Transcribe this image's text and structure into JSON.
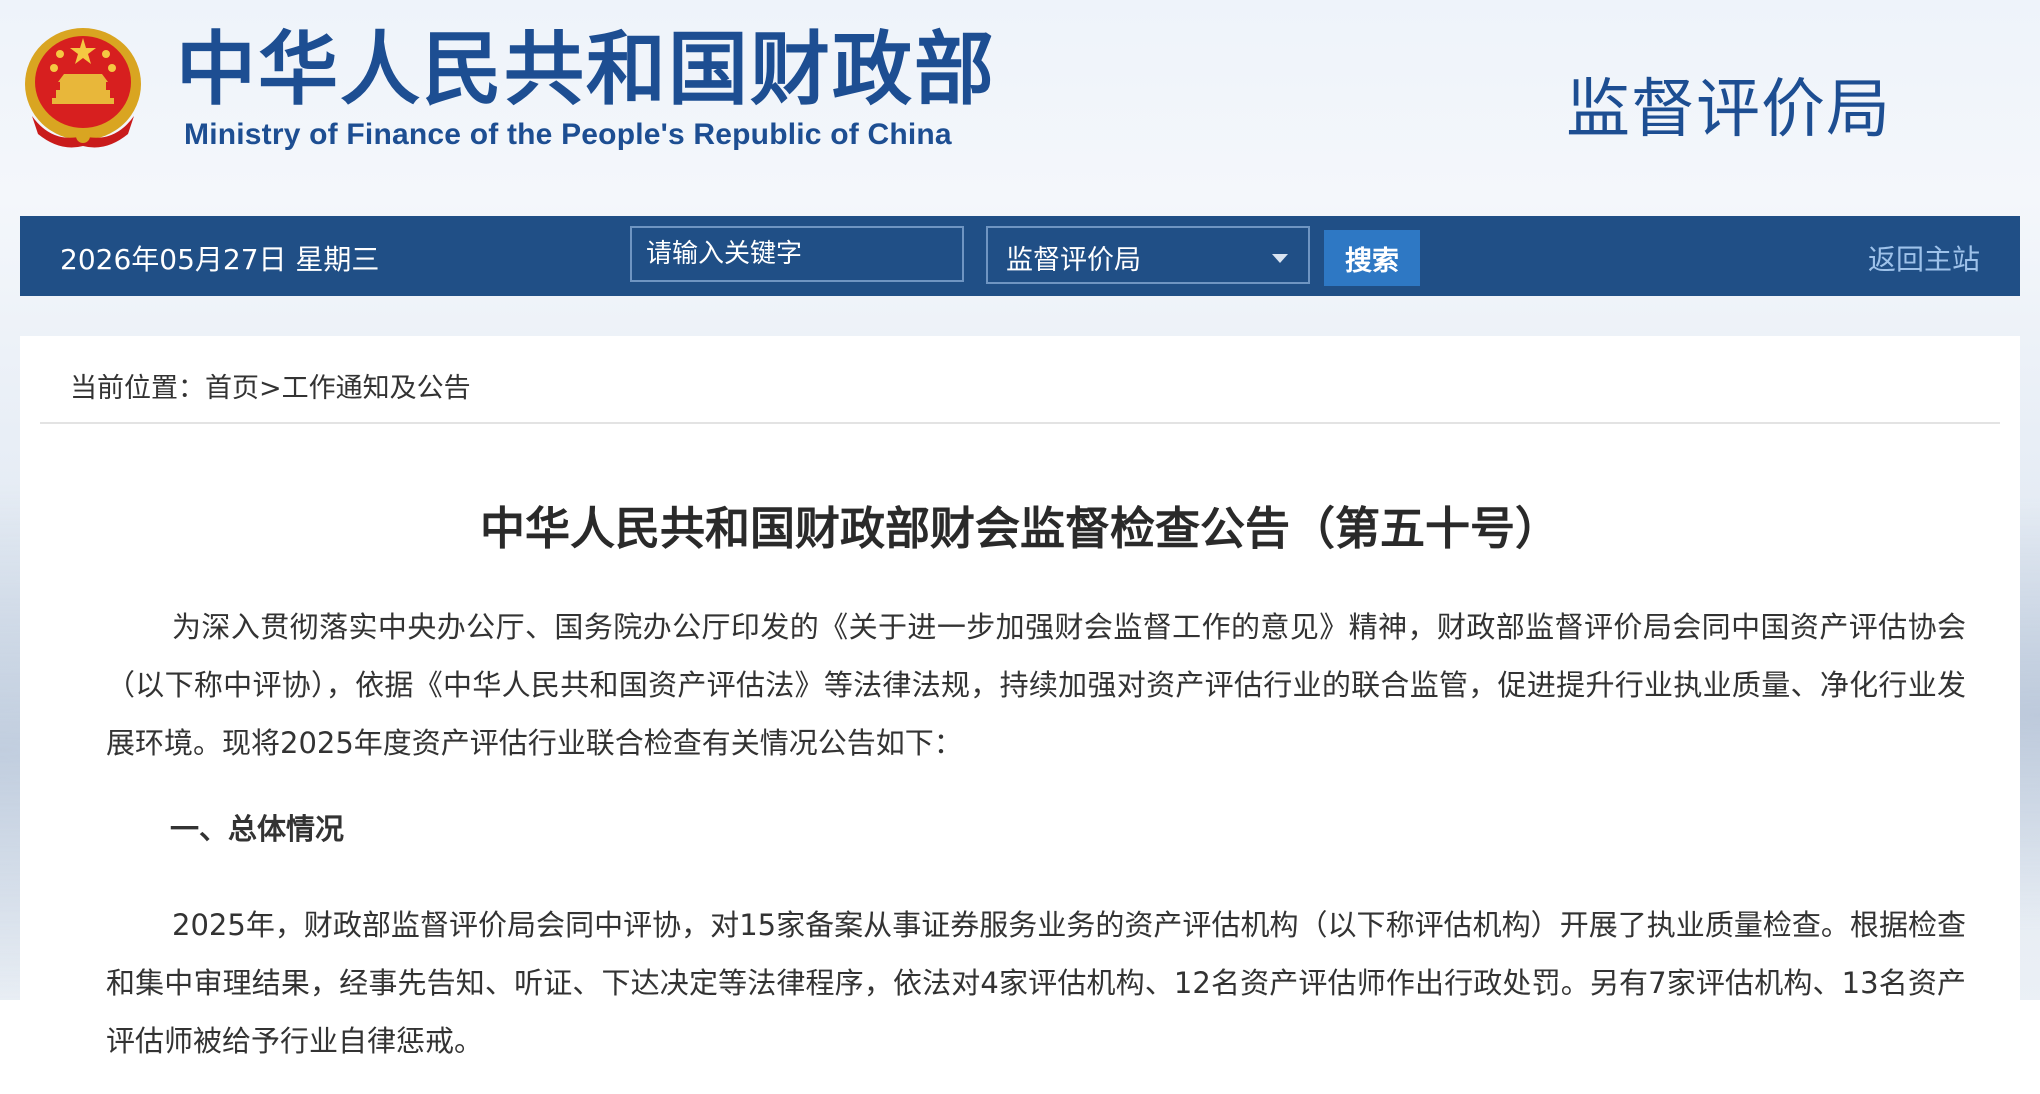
{
  "header": {
    "ministry_cn": "中华人民共和国财政部",
    "ministry_en": "Ministry of Finance of the People's Republic of China",
    "department": "监督评价局"
  },
  "navbar": {
    "date": "2026年05月27日  星期三",
    "search_placeholder": "请输入关键字",
    "scope_selected": "监督评价局",
    "search_button": "搜索",
    "home_link": "返回主站"
  },
  "breadcrumb": {
    "label": "当前位置：",
    "home": "首页",
    "separator": ">",
    "current": "工作通知及公告"
  },
  "article": {
    "title": "中华人民共和国财政部财会监督检查公告（第五十号）",
    "paragraph_1": "为深入贯彻落实中央办公厅、国务院办公厅印发的《关于进一步加强财会监督工作的意见》精神，财政部监督评价局会同中国资产评估协会（以下称中评协），依据《中华人民共和国资产评估法》等法律法规，持续加强对资产评估行业的联合监管，促进提升行业执业质量、净化行业发展环境。现将2025年度资产评估行业联合检查有关情况公告如下：",
    "section_1_heading": "一、总体情况",
    "paragraph_2": "2025年，财政部监督评价局会同中评协，对15家备案从事证券服务业务的资产评估机构（以下称评估机构）开展了执业质量检查。根据检查和集中审理结果，经事先告知、听证、下达决定等法律程序，依法对4家评估机构、12名资产评估师作出行政处罚。另有7家评估机构、13名资产评估师被给予行业自律惩戒。"
  },
  "colors": {
    "brand_blue": "#1d4e92",
    "navbar_bg": "#204f86",
    "button_blue": "#2e78c4",
    "home_link": "#9ec2ea"
  }
}
